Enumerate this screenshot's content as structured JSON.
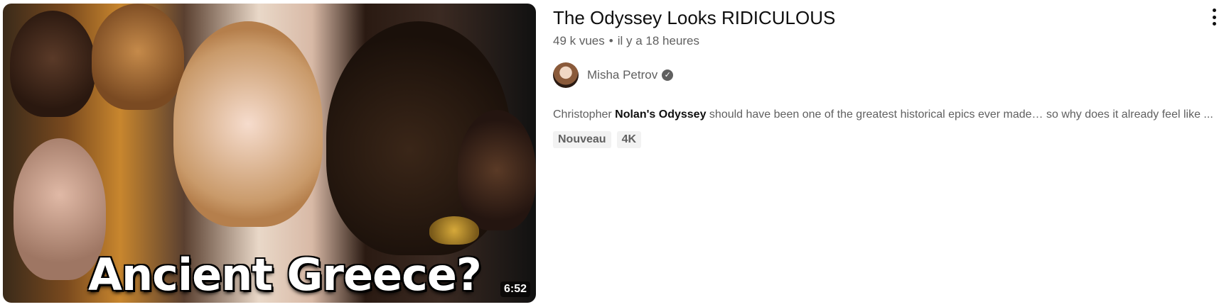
{
  "video": {
    "title": "The Odyssey Looks RIDICULOUS",
    "views": "49 k vues",
    "separator": "•",
    "age": "il y a 18 heures",
    "duration": "6:52",
    "thumbnail_text": "Ancient Greece?"
  },
  "channel": {
    "name": "Misha Petrov",
    "verified_icon": "verified-check-icon"
  },
  "description": {
    "part1": "Christopher ",
    "bold": "Nolan's Odyssey",
    "part2": " should have been one of the greatest historical epics ever made… so why does it already feel like ..."
  },
  "badges": [
    "Nouveau",
    "4K"
  ],
  "menu_icon": "more-vertical-icon"
}
